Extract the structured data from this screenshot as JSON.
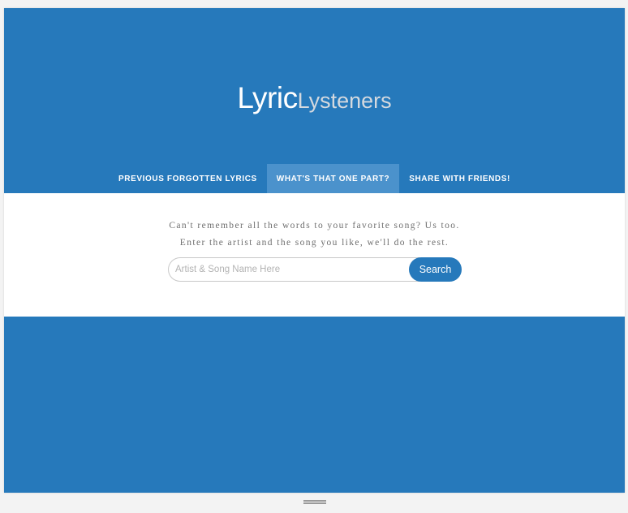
{
  "logo": {
    "primary": "Lyric",
    "secondary": "Lysteners"
  },
  "nav": {
    "items": [
      {
        "label": "PREVIOUS FORGOTTEN LYRICS",
        "active": false
      },
      {
        "label": "WHAT'S THAT ONE PART?",
        "active": true
      },
      {
        "label": "SHARE WITH FRIENDS!",
        "active": false
      }
    ]
  },
  "main": {
    "tagline_1": "Can't remember all the words to your favorite song? Us too.",
    "tagline_2": "Enter the artist and the song you like, we'll do the rest."
  },
  "search": {
    "placeholder": "Artist & Song Name Here",
    "value": "",
    "button_label": "Search"
  },
  "colors": {
    "brand": "#2679bb",
    "nav_active": "#4b92cc",
    "logo_secondary": "#d4d9df"
  },
  "icons": [
    "resize-handle-icon"
  ]
}
